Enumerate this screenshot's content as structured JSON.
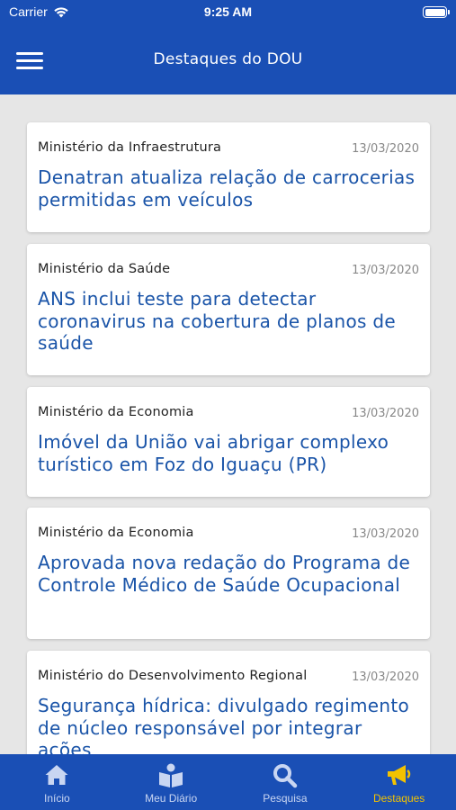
{
  "status_bar": {
    "carrier": "Carrier",
    "time": "9:25 AM"
  },
  "header": {
    "title": "Destaques do DOU"
  },
  "articles": [
    {
      "ministry": "Ministério da Infraestrutura",
      "date": "13/03/2020",
      "title": "Denatran atualiza relação de carrocerias permitidas em veículos"
    },
    {
      "ministry": "Ministério da Saúde",
      "date": "13/03/2020",
      "title": "ANS inclui teste para detectar coronavirus na cobertura de planos de saúde"
    },
    {
      "ministry": "Ministério da Economia",
      "date": "13/03/2020",
      "title": "Imóvel da União vai abrigar complexo turístico em Foz do Iguaçu (PR)"
    },
    {
      "ministry": "Ministério da Economia",
      "date": "13/03/2020",
      "title": "Aprovada nova redação do Programa de Controle Médico de Saúde Ocupacional"
    },
    {
      "ministry": "Ministério do Desenvolvimento Regional",
      "date": "13/03/2020",
      "title": "Segurança hídrica: divulgado regimento de núcleo responsável por integrar ações"
    }
  ],
  "tabbar": {
    "tabs": [
      {
        "label": "Início",
        "icon": "home-icon"
      },
      {
        "label": "Meu Diário",
        "icon": "book-reader-icon"
      },
      {
        "label": "Pesquisa",
        "icon": "search-icon"
      },
      {
        "label": "Destaques",
        "icon": "megaphone-icon"
      }
    ],
    "active_index": 3
  },
  "colors": {
    "primary": "#1a4fb5",
    "headline": "#1a54a8",
    "active_tab": "#f2c200",
    "background": "#e6e6e6"
  }
}
